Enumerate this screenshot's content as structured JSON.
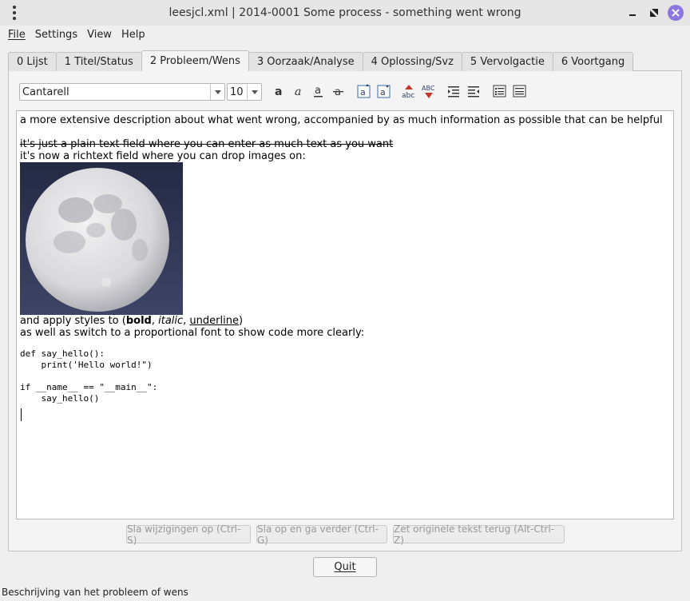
{
  "window": {
    "title": "leesjcl.xml | 2014-0001 Some process - something went wrong"
  },
  "menu": [
    "File",
    "Settings",
    "View",
    "Help"
  ],
  "tabs": [
    {
      "label": "0 Lijst"
    },
    {
      "label": "1 Titel/Status"
    },
    {
      "label": "2 Probleem/Wens",
      "active": true
    },
    {
      "label": "3 Oorzaak/Analyse"
    },
    {
      "label": "4 Oplossing/Svz"
    },
    {
      "label": "5 Vervolgactie"
    },
    {
      "label": "6 Voortgang"
    }
  ],
  "toolbar": {
    "font": "Cantarell",
    "size": "10",
    "buttons": [
      "bold-icon",
      "italic-icon",
      "underline-icon",
      "strikethrough-icon",
      "enlarge-text-icon",
      "shrink-text-icon",
      "spellcheck-icon",
      "spellcheck-options-icon",
      "indent-icon",
      "unindent-icon",
      "list-icon",
      "numbered-list-icon"
    ]
  },
  "editor": {
    "line1": "a more extensive description about what went wrong, accompanied by as much information as possible that can be helpful",
    "line2_strike": "it's just a plain text field where you can enter as much text as you want",
    "line3": "it's now a richtext field where you can drop images on:",
    "styles_prefix": "and apply styles to (",
    "bold": "bold",
    "sep1": ", ",
    "italic": "italic",
    "sep2": ", ",
    "underline": "underline",
    "styles_suffix": ")",
    "line5": "as well as switch to a proportional font to show code more clearly:",
    "code": "def say_hello():\n    print('Hello world!\")\n\nif __name__ == \"__main__\":\n    say_hello()"
  },
  "buttons": {
    "save": "Sla wijzigingen op (Ctrl-S)",
    "save_next": "Sla op en ga verder (Ctrl-G)",
    "revert": "Zet originele tekst terug (Alt-Ctrl-Z)",
    "quit": "Quit"
  },
  "status": "Beschrijving van het probleem of wens",
  "colors": {
    "close_button": "#8b77e0"
  }
}
